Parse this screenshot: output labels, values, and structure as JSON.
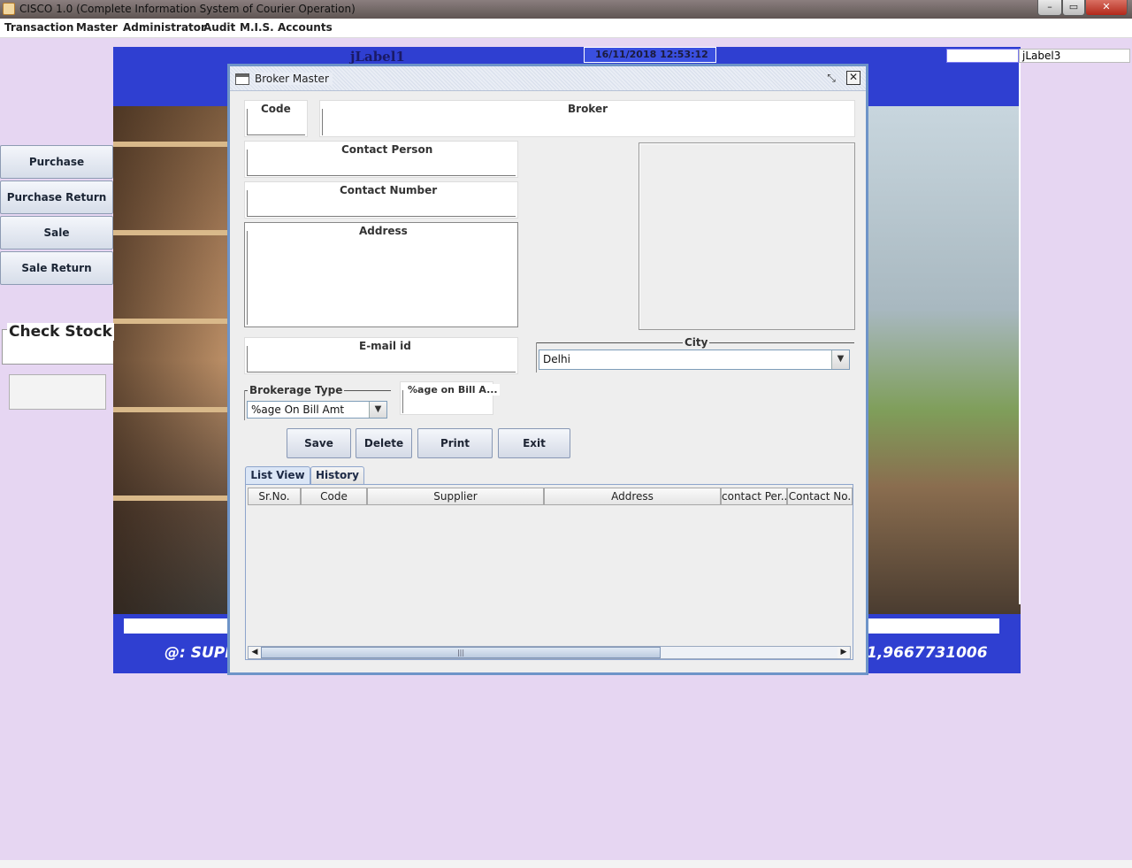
{
  "window": {
    "title": "CISCO 1.0 (Complete Information System of Courier Operation)",
    "min": "–",
    "max": "▭",
    "close": "✕"
  },
  "menu": {
    "items": [
      "Transaction",
      "Master",
      "Administrator",
      "Audit",
      "M.I.S.",
      "Accounts"
    ]
  },
  "background": {
    "jlabel1": "jLabel1",
    "datetime": "16/11/2018    12:53:12",
    "jlabel3": "jLabel3",
    "footer_left": "@: SUPI",
    "footer_right": "1,9667731006"
  },
  "sidebar": {
    "buttons": [
      "Purchase",
      "Purchase Return",
      "Sale",
      "Sale Return"
    ],
    "check_stock_title": "Check Stock"
  },
  "frame": {
    "title": "Broker Master",
    "restore": "⤡",
    "close": "✕",
    "fields": {
      "code": "Code",
      "broker": "Broker",
      "contact_person": "Contact Person",
      "contact_number": "Contact Number",
      "address": "Address",
      "email": "E-mail id",
      "city": "City",
      "city_value": "Delhi",
      "brokerage_type": "Brokerage Type",
      "brokerage_type_value": "%age On Bill Amt",
      "pct_on_bill": "%age on Bill A..."
    },
    "buttons": {
      "save": "Save",
      "delete": "Delete",
      "print": "Print",
      "exit": "Exit"
    },
    "tabs": [
      "List View",
      "History"
    ],
    "table": {
      "columns": [
        "Sr.No.",
        "Code",
        "Supplier",
        "Address",
        "contact Per...",
        "Contact No."
      ],
      "rows": []
    },
    "scroll_thumb": "|||",
    "scroll_left": "◀",
    "scroll_right": "▶",
    "combo_arrow": "▼"
  },
  "colors": {
    "desktop": "#e6d6f2",
    "frame_border": "#6e94c8",
    "banner_blue": "#2f3fd1"
  }
}
